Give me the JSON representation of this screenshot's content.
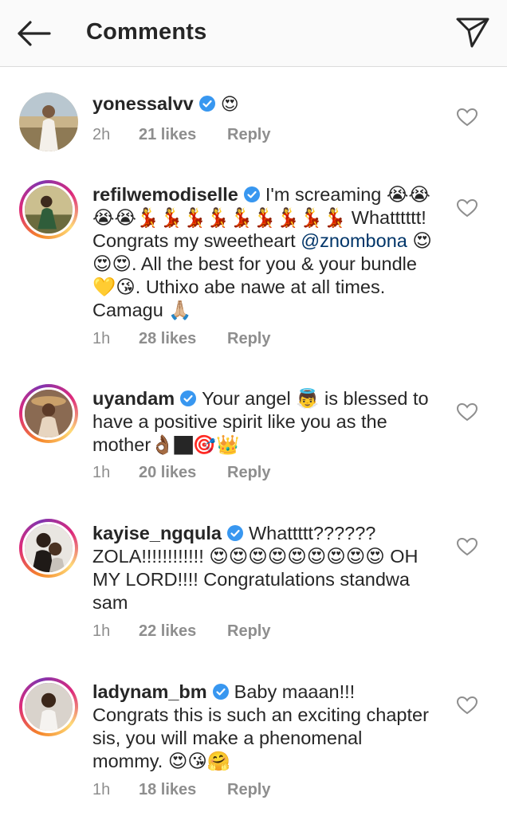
{
  "header": {
    "title": "Comments",
    "back_icon": "arrow-left-icon",
    "send_icon": "paper-plane-icon"
  },
  "verified_icon": "verified-badge-icon",
  "heart_icon": "heart-outline-icon",
  "comments": [
    {
      "username": "yonessalvv",
      "text": "😍",
      "time": "2h",
      "likes": "21 likes",
      "reply": "Reply"
    },
    {
      "username": "refilwemodiselle",
      "text_part1": "I'm screaming 😭😭😭😭💃💃💃💃💃💃💃💃💃 Whatttttt! Congrats my sweetheart ",
      "mention": "@znombona",
      "text_part2": " 😍😍😍. All the best for you & your bundle 💛😘. Uthixo abe nawe at all times. Camagu 🙏🏼",
      "time": "1h",
      "likes": "28 likes",
      "reply": "Reply"
    },
    {
      "username": "uyandam",
      "text": "Your angel 👼 is blessed to have a positive spirit like you as the mother👌🏾🏿🎯👑",
      "time": "1h",
      "likes": "20 likes",
      "reply": "Reply"
    },
    {
      "username": "kayise_ngqula",
      "text": "Whattttt?????? ZOLA!!!!!!!!!!!! 😍😍😍😍😍😍😍😍😍 OH MY LORD!!!! Congratulations standwa sam",
      "time": "1h",
      "likes": "22 likes",
      "reply": "Reply"
    },
    {
      "username": "ladynam_bm",
      "text": "Baby maaan!!! Congrats this is such an exciting chapter sis, you will make a phenomenal mommy. 😍😘🤗",
      "time": "1h",
      "likes": "18 likes",
      "reply": "Reply"
    }
  ]
}
